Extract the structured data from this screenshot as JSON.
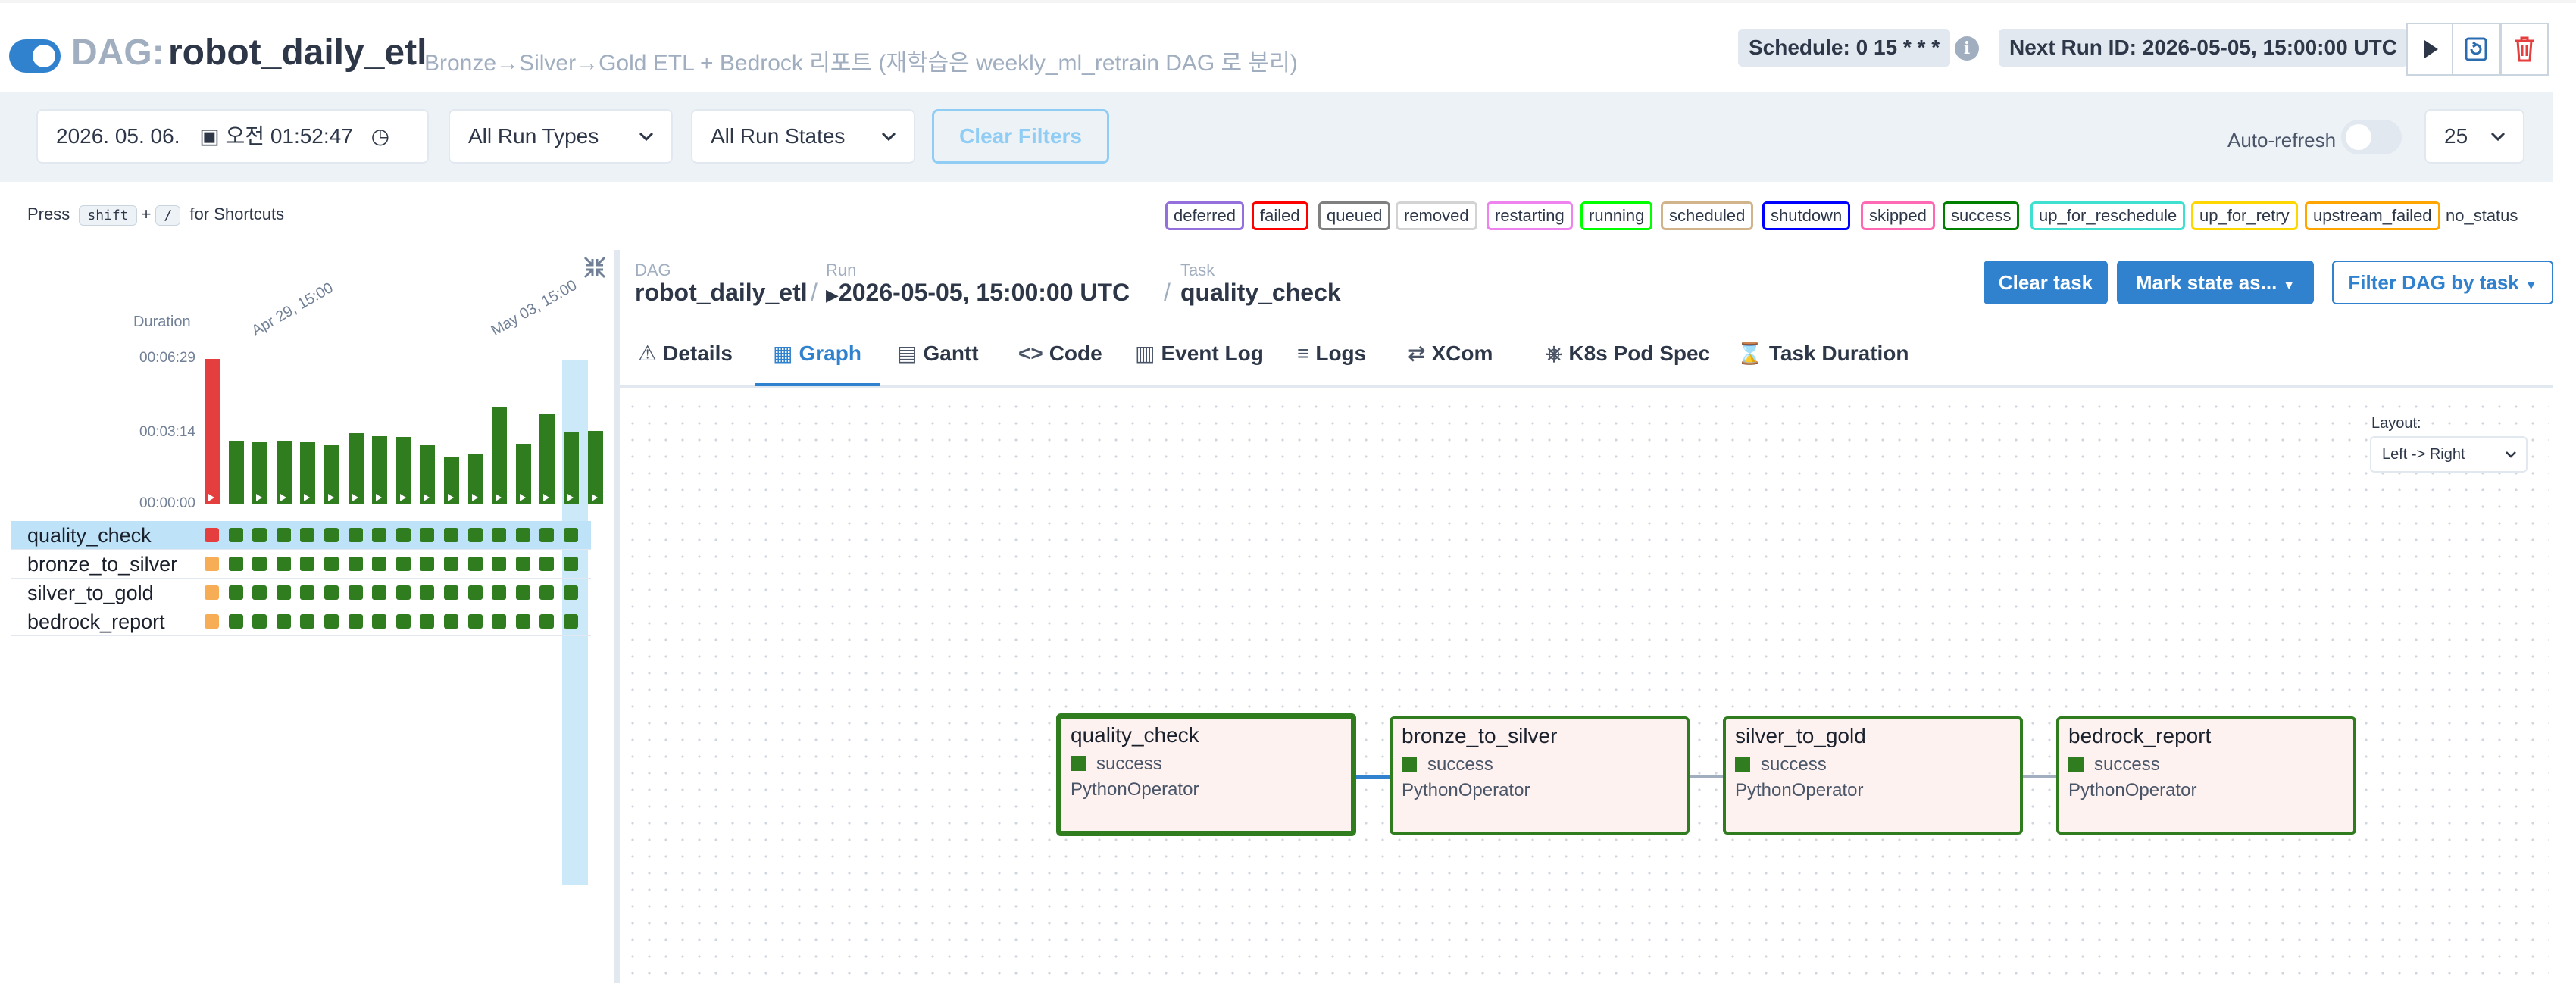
{
  "header": {
    "dag_label": "DAG:",
    "dag_id": "robot_daily_etl",
    "description": "Bronze→Silver→Gold ETL + Bedrock 리포트 (재학습은 weekly_ml_retrain DAG 로 분리)",
    "schedule": "Schedule: 0 15 * * *",
    "info_icon": "i",
    "next_run": "Next Run ID: 2026-05-05, 15:00:00 UTC",
    "buttons": [
      "play-icon",
      "refresh-icon",
      "trash-icon"
    ]
  },
  "filters": {
    "date_value": "2026. 05. 06.",
    "time_value": "오전 01:52:47",
    "run_types": "All Run Types",
    "run_states": "All Run States",
    "clear_filters": "Clear Filters",
    "auto_refresh": "Auto-refresh",
    "auto_refresh_on": false,
    "num_runs": "25"
  },
  "shortcuts": {
    "press": "Press",
    "key1": "shift",
    "plus": "+",
    "key2": "/",
    "suffix": "for Shortcuts"
  },
  "legend": [
    {
      "label": "deferred",
      "color": "#9370db"
    },
    {
      "label": "failed",
      "color": "#ff0000"
    },
    {
      "label": "queued",
      "color": "#808080"
    },
    {
      "label": "removed",
      "color": "#d3d3d3"
    },
    {
      "label": "restarting",
      "color": "#ee82ee"
    },
    {
      "label": "running",
      "color": "#00ff00"
    },
    {
      "label": "scheduled",
      "color": "#d2b48c"
    },
    {
      "label": "shutdown",
      "color": "#0000ff"
    },
    {
      "label": "skipped",
      "color": "#ff69b4"
    },
    {
      "label": "success",
      "color": "#008000"
    },
    {
      "label": "up_for_reschedule",
      "color": "#40e0d0"
    },
    {
      "label": "up_for_retry",
      "color": "#ffd700"
    },
    {
      "label": "upstream_failed",
      "color": "#ffa500"
    },
    {
      "label": "no_status",
      "color": "none"
    }
  ],
  "grid": {
    "duration_label": "Duration",
    "date_labels": [
      "Apr 29, 15:00",
      "May 03, 15:00"
    ],
    "ticks": [
      "00:06:29",
      "00:03:14",
      "00:00:00"
    ],
    "duration_max_seconds": 389,
    "run_durations_seconds": [
      389,
      170,
      168,
      170,
      168,
      160,
      190,
      183,
      180,
      160,
      128,
      135,
      262,
      163,
      242,
      192,
      197
    ],
    "run_states": [
      "failed",
      "success",
      "success",
      "success",
      "success",
      "success",
      "success",
      "success",
      "success",
      "success",
      "success",
      "success",
      "success",
      "success",
      "success",
      "success",
      "success"
    ],
    "tasks": [
      {
        "name": "quality_check",
        "selected": true,
        "states": [
          "failed",
          "success",
          "success",
          "success",
          "success",
          "success",
          "success",
          "success",
          "success",
          "success",
          "success",
          "success",
          "success",
          "success",
          "success",
          "success"
        ]
      },
      {
        "name": "bronze_to_silver",
        "selected": false,
        "states": [
          "upstream_failed",
          "success",
          "success",
          "success",
          "success",
          "success",
          "success",
          "success",
          "success",
          "success",
          "success",
          "success",
          "success",
          "success",
          "success",
          "success"
        ]
      },
      {
        "name": "silver_to_gold",
        "selected": false,
        "states": [
          "upstream_failed",
          "success",
          "success",
          "success",
          "success",
          "success",
          "success",
          "success",
          "success",
          "success",
          "success",
          "success",
          "success",
          "success",
          "success",
          "success"
        ]
      },
      {
        "name": "bedrock_report",
        "selected": false,
        "states": [
          "upstream_failed",
          "success",
          "success",
          "success",
          "success",
          "success",
          "success",
          "success",
          "success",
          "success",
          "success",
          "success",
          "success",
          "success",
          "success",
          "success"
        ]
      }
    ]
  },
  "breadcrumb": {
    "dag_small": "DAG",
    "dag_value": "robot_daily_etl",
    "run_small": "Run",
    "run_value": "2026-05-05, 15:00:00 UTC",
    "task_small": "Task",
    "task_value": "quality_check",
    "sep": "/"
  },
  "actions": {
    "clear_task": "Clear task",
    "mark_state": "Mark state as...",
    "filter_dag": "Filter DAG by task"
  },
  "tabs": [
    {
      "label": "Details",
      "icon": "warning-icon",
      "glyph": "⚠"
    },
    {
      "label": "Graph",
      "icon": "graph-icon",
      "glyph": "▦"
    },
    {
      "label": "Gantt",
      "icon": "gantt-icon",
      "glyph": "▤"
    },
    {
      "label": "Code",
      "icon": "code-icon",
      "glyph": "<>"
    },
    {
      "label": "Event Log",
      "icon": "event-log-icon",
      "glyph": "▥"
    },
    {
      "label": "Logs",
      "icon": "logs-icon",
      "glyph": "≡"
    },
    {
      "label": "XCom",
      "icon": "xcom-icon",
      "glyph": "⇄"
    },
    {
      "label": "K8s Pod Spec",
      "icon": "k8s-icon",
      "glyph": "⎈"
    },
    {
      "label": "Task Duration",
      "icon": "hourglass-icon",
      "glyph": "⌛"
    }
  ],
  "active_tab": "Graph",
  "graph": {
    "layout_label": "Layout:",
    "layout_value": "Left -> Right",
    "nodes": [
      {
        "name": "quality_check",
        "state": "success",
        "operator": "PythonOperator",
        "selected": true
      },
      {
        "name": "bronze_to_silver",
        "state": "success",
        "operator": "PythonOperator",
        "selected": false
      },
      {
        "name": "silver_to_gold",
        "state": "success",
        "operator": "PythonOperator",
        "selected": false
      },
      {
        "name": "bedrock_report",
        "state": "success",
        "operator": "PythonOperator",
        "selected": false
      }
    ]
  },
  "colors": {
    "accent": "#3182ce",
    "success": "#2f7d1e",
    "failed": "#e53e3e",
    "upstream_failed": "#f6ad55"
  }
}
